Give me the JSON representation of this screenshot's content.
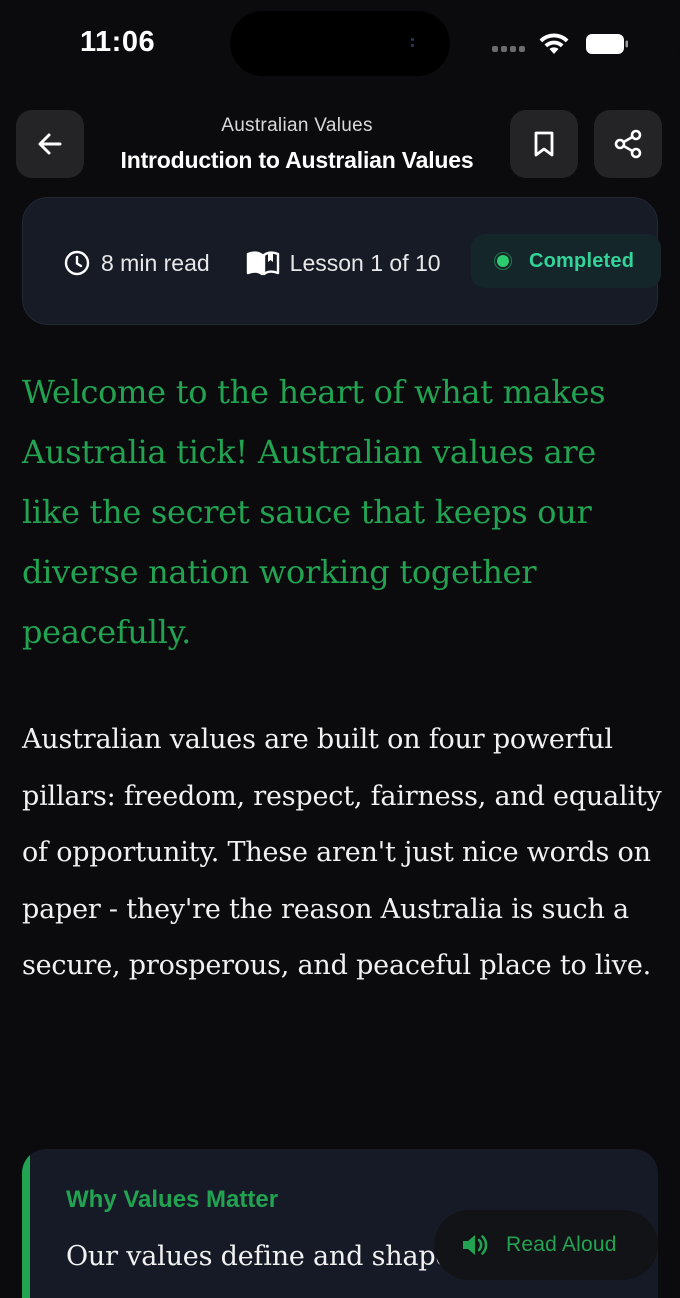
{
  "status_bar": {
    "time": "11:06"
  },
  "header": {
    "category": "Australian Values",
    "title": "Introduction to Australian Values"
  },
  "meta": {
    "read_time": "8 min read",
    "lesson_progress": "Lesson 1 of 10",
    "status": "Completed"
  },
  "content": {
    "lede": "Welcome to the heart of what makes Australia tick! Australian values are like the secret sauce that keeps our diverse nation working together peacefully.",
    "paragraph": "Australian values are built on four powerful pillars: freedom, respect, fairness, and equality of opportunity. These aren't just nice words on paper - they're the reason Australia is such a secure, prosperous, and peaceful place to live."
  },
  "callout": {
    "title": "Why Values Matter",
    "text": "Our values define and shape"
  },
  "read_aloud": {
    "label": "Read Aloud"
  },
  "icons": {
    "back": "arrow-left-icon",
    "bookmark": "bookmark-icon",
    "share": "share-icon",
    "clock": "clock-icon",
    "book": "book-open-icon",
    "speaker": "speaker-icon"
  },
  "colors": {
    "accent_green": "#22a352",
    "completed_green": "#34d399",
    "card_bg": "#161b26",
    "background": "#0b0b0d"
  }
}
